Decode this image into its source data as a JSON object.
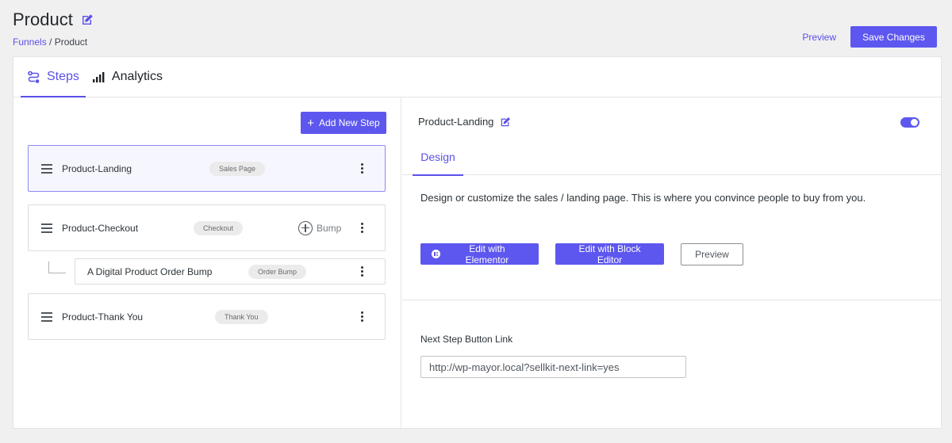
{
  "header": {
    "title": "Product",
    "breadcrumb": {
      "parent": "Funnels",
      "separator": "/",
      "current": "Product"
    }
  },
  "top_actions": {
    "preview_label": "Preview",
    "save_label": "Save Changes"
  },
  "colors": {
    "accent": "#5d57ef",
    "link": "#5a50e8",
    "selected_border": "#8d88f2"
  },
  "tabs": [
    {
      "label": "Steps",
      "icon": "steps-flow-icon",
      "active": true
    },
    {
      "label": "Analytics",
      "icon": "bar-chart-icon",
      "active": false
    }
  ],
  "steps_panel": {
    "add_label": "Add New Step",
    "steps": [
      {
        "name": "Product-Landing",
        "type": "Sales Page",
        "selected": true
      },
      {
        "name": "Product-Checkout",
        "type": "Checkout",
        "bump_label": "Bump"
      },
      {
        "name": "A Digital Product Order Bump",
        "type": "Order Bump",
        "child": true
      },
      {
        "name": "Product-Thank You",
        "type": "Thank You"
      }
    ]
  },
  "detail": {
    "step_name": "Product-Landing",
    "enabled": true,
    "sub_tab": "Design",
    "description": "Design or customize the sales / landing page. This is where you convince people to buy from you.",
    "buttons": {
      "elementor": "Edit with Elementor",
      "block_editor": "Edit with Block Editor",
      "preview": "Preview"
    },
    "next_link": {
      "label": "Next Step Button Link",
      "value": "http://wp-mayor.local?sellkit-next-link=yes"
    }
  }
}
